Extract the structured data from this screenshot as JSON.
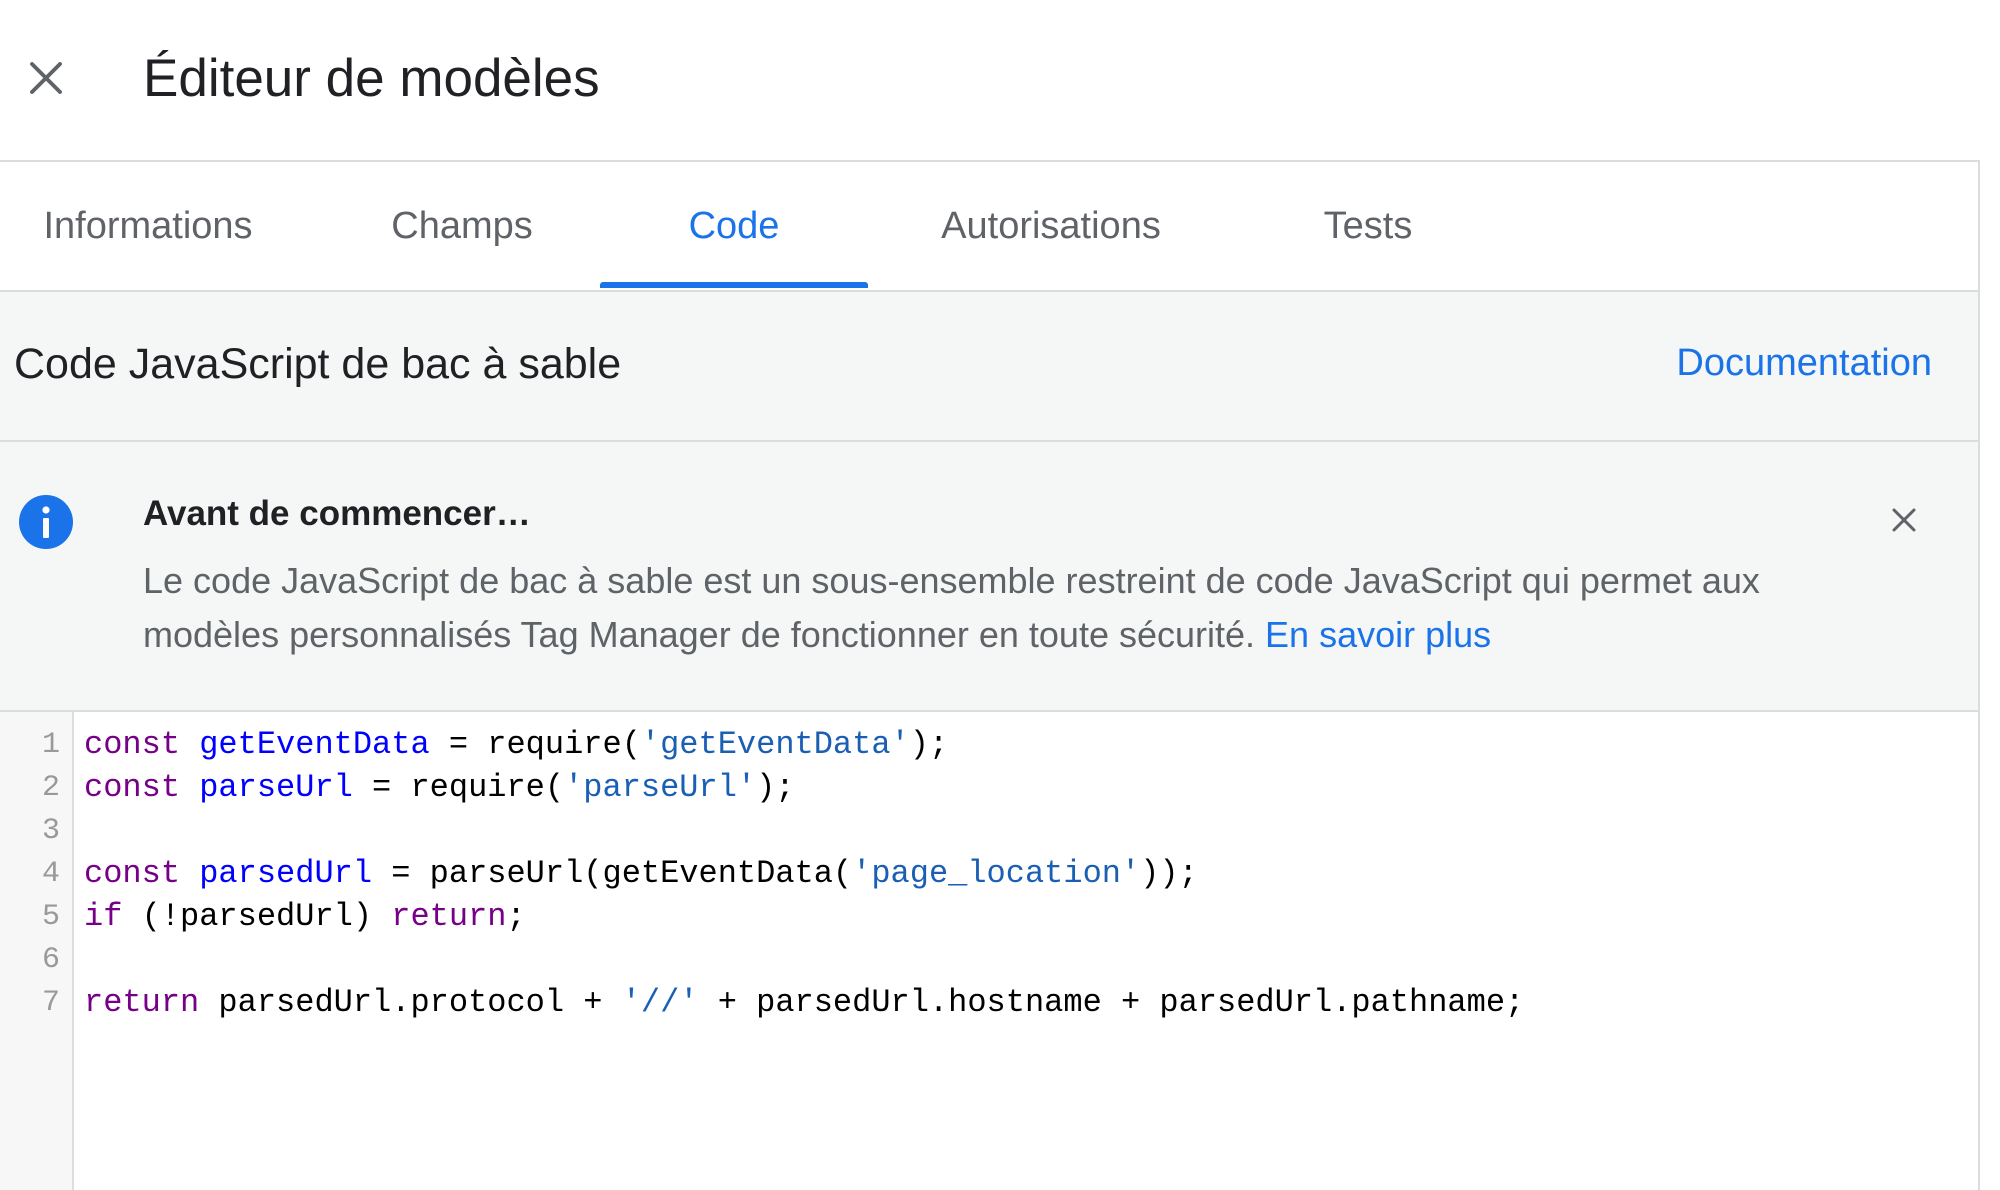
{
  "header": {
    "title": "Éditeur de modèles",
    "close_icon": "close-icon"
  },
  "tabs": [
    {
      "label": "Informations",
      "active": false
    },
    {
      "label": "Champs",
      "active": false
    },
    {
      "label": "Code",
      "active": true
    },
    {
      "label": "Autorisations",
      "active": false
    },
    {
      "label": "Tests",
      "active": false
    }
  ],
  "section": {
    "title": "Code JavaScript de bac à sable",
    "doc_link": "Documentation"
  },
  "banner": {
    "icon": "info-icon",
    "title": "Avant de commencer…",
    "text": "Le code JavaScript de bac à sable est un sous-ensemble restreint de code JavaScript qui permet aux modèles personnalisés Tag Manager de fonctionner en toute sécurité.",
    "link": "En savoir plus",
    "close_icon": "close-icon"
  },
  "editor": {
    "lines": [
      {
        "n": "1",
        "tokens": [
          [
            "kw",
            "const"
          ],
          [
            "",
            " "
          ],
          [
            "def",
            "getEventData"
          ],
          [
            "",
            " = require("
          ],
          [
            "str",
            "'getEventData'"
          ],
          [
            "",
            ");"
          ]
        ]
      },
      {
        "n": "2",
        "tokens": [
          [
            "kw",
            "const"
          ],
          [
            "",
            " "
          ],
          [
            "def",
            "parseUrl"
          ],
          [
            "",
            " = require("
          ],
          [
            "str",
            "'parseUrl'"
          ],
          [
            "",
            ");"
          ]
        ]
      },
      {
        "n": "3",
        "tokens": []
      },
      {
        "n": "4",
        "tokens": [
          [
            "kw",
            "const"
          ],
          [
            "",
            " "
          ],
          [
            "def",
            "parsedUrl"
          ],
          [
            "",
            " = parseUrl(getEventData("
          ],
          [
            "str",
            "'page_location'"
          ],
          [
            "",
            "));"
          ]
        ]
      },
      {
        "n": "5",
        "tokens": [
          [
            "kw",
            "if"
          ],
          [
            "",
            " (!parsedUrl) "
          ],
          [
            "kw",
            "return"
          ],
          [
            "",
            ";"
          ]
        ]
      },
      {
        "n": "6",
        "tokens": []
      },
      {
        "n": "7",
        "tokens": [
          [
            "kw",
            "return"
          ],
          [
            "",
            " parsedUrl.protocol + "
          ],
          [
            "str",
            "'//'"
          ],
          [
            "",
            " + parsedUrl.hostname + parsedUrl.pathname;"
          ]
        ]
      }
    ]
  },
  "colors": {
    "accent": "#1a73e8",
    "keyword": "#770088",
    "definition": "#0000ff",
    "string": "#1a5fb4"
  }
}
